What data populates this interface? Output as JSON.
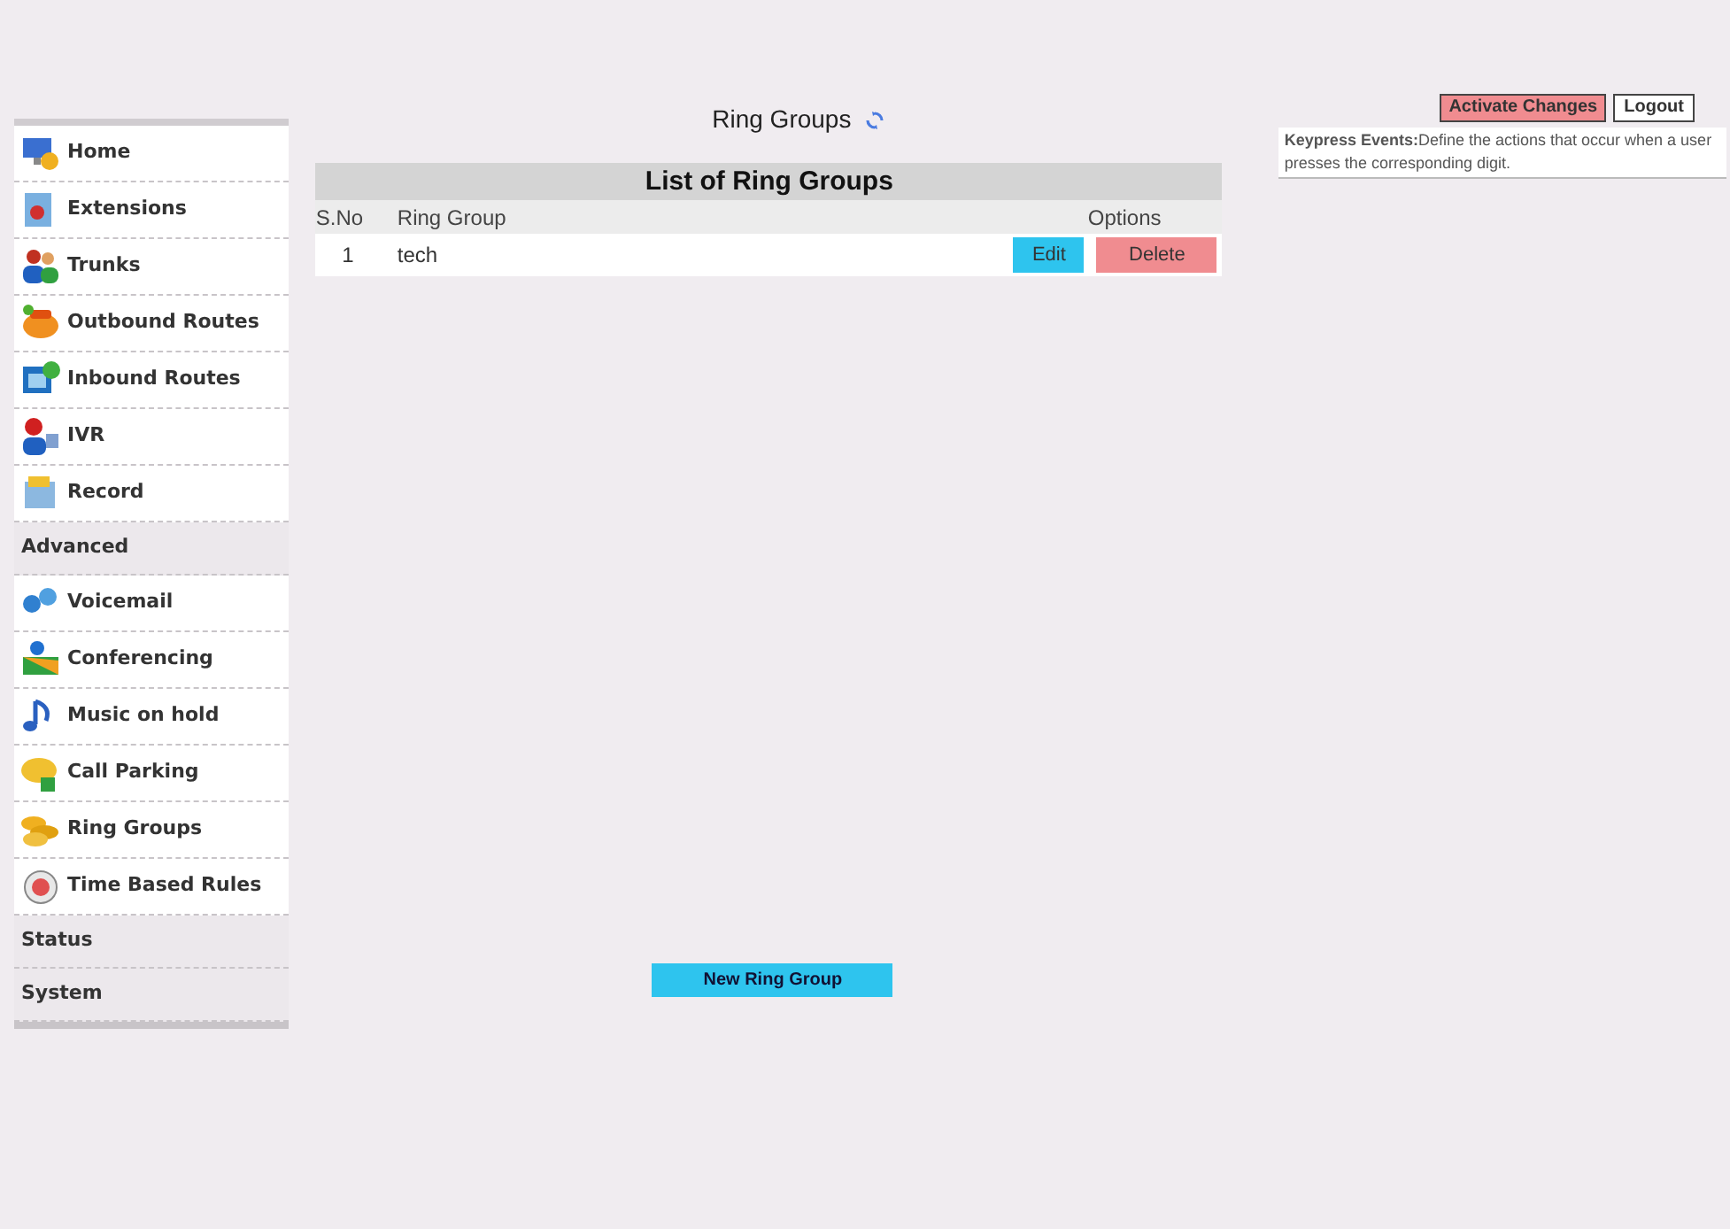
{
  "sidebar": {
    "items": [
      {
        "kind": "item",
        "label": "Home"
      },
      {
        "kind": "item",
        "label": "Extensions"
      },
      {
        "kind": "item",
        "label": "Trunks"
      },
      {
        "kind": "item",
        "label": "Outbound Routes"
      },
      {
        "kind": "item",
        "label": "Inbound Routes"
      },
      {
        "kind": "item",
        "label": "IVR"
      },
      {
        "kind": "item",
        "label": "Record"
      },
      {
        "kind": "section",
        "label": "Advanced"
      },
      {
        "kind": "item",
        "label": "Voicemail"
      },
      {
        "kind": "item",
        "label": "Conferencing"
      },
      {
        "kind": "item",
        "label": "Music on hold"
      },
      {
        "kind": "item",
        "label": "Call Parking"
      },
      {
        "kind": "item",
        "label": "Ring Groups"
      },
      {
        "kind": "item",
        "label": "Time Based Rules"
      },
      {
        "kind": "section",
        "label": "Status"
      },
      {
        "kind": "section",
        "label": "System"
      }
    ]
  },
  "page_title": "Ring Groups",
  "table": {
    "title": "List of Ring Groups",
    "columns": [
      "S.No",
      "Ring Group",
      "Options"
    ],
    "rows": [
      {
        "sno": "1",
        "name": "tech",
        "edit": "Edit",
        "delete": "Delete"
      }
    ]
  },
  "new_button": "New Ring Group",
  "top_buttons": {
    "activate": "Activate Changes",
    "logout": "Logout"
  },
  "help": "**Keypress Events:**Define the actions that occur when a user presses the corresponding digit."
}
